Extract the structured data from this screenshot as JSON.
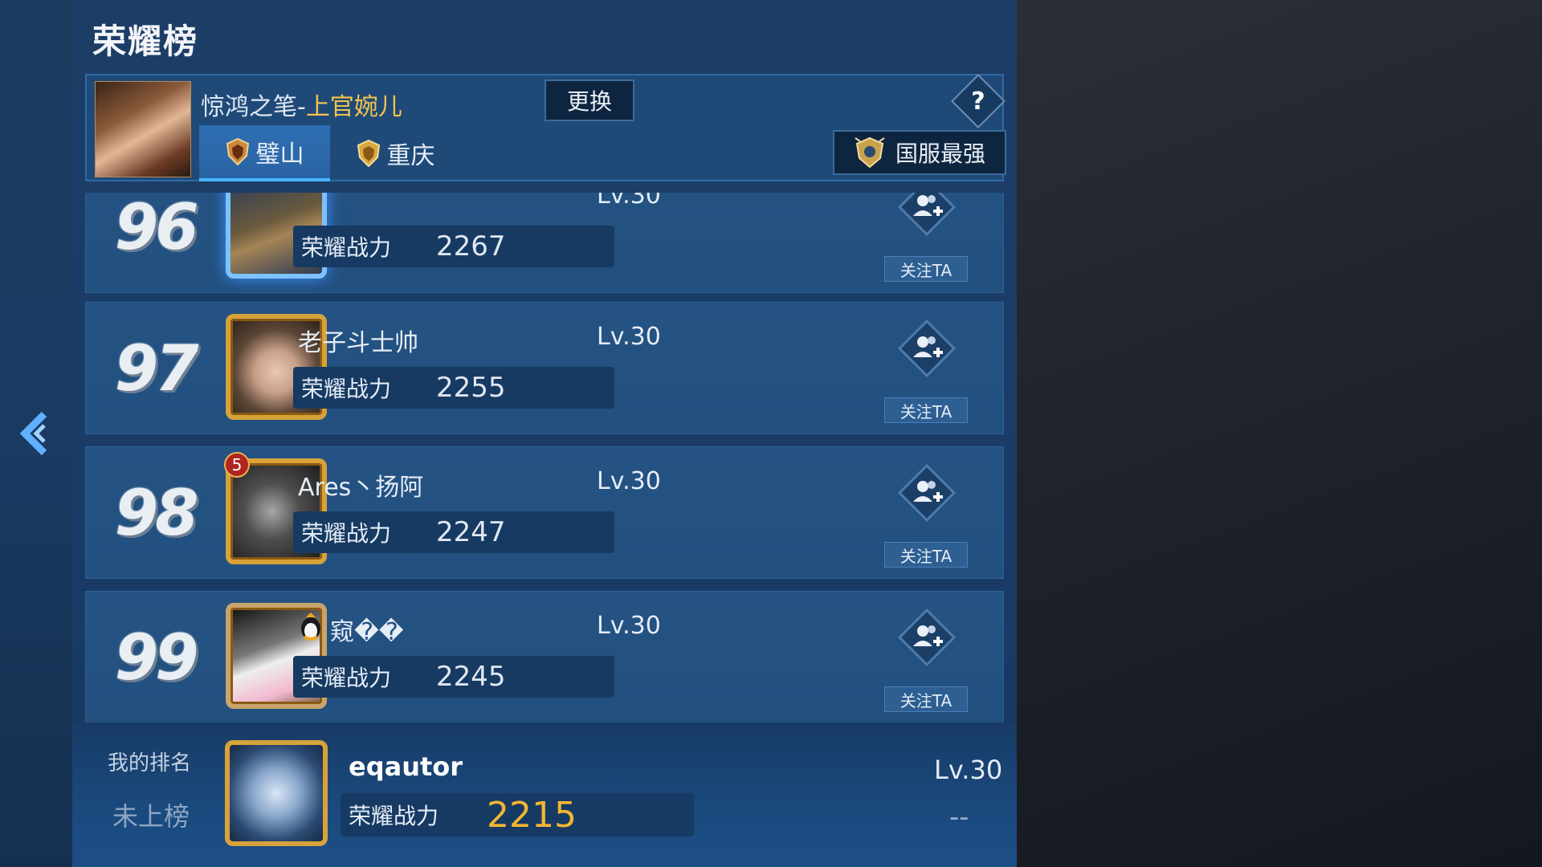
{
  "screen": {
    "title": "荣耀榜",
    "hero": {
      "name_prefix": "惊鸿之笔-",
      "name_highlight": "上官婉儿",
      "change_label": "更换",
      "help_label": "?"
    },
    "tabs": [
      {
        "label": "璧山",
        "active": true
      },
      {
        "label": "重庆",
        "active": false
      }
    ],
    "national_label": "国服最强"
  },
  "power_label": "荣耀战力",
  "follow_label": "关注TA",
  "rows": [
    {
      "rank": "96",
      "name": "",
      "level": "Lv.30",
      "power": "2267"
    },
    {
      "rank": "97",
      "name": "老子斗士帅",
      "level": "Lv.30",
      "power": "2255"
    },
    {
      "rank": "98",
      "name": "Ares丶扬阿",
      "level": "Lv.30",
      "power": "2247",
      "badge": "5"
    },
    {
      "rank": "99",
      "name": "窥��",
      "level": "Lv.30",
      "power": "2245"
    }
  ],
  "me": {
    "label": "我的排名",
    "status": "未上榜",
    "name": "eqautor",
    "level": "Lv.30",
    "power": "2215",
    "extra": "--"
  },
  "colors": {
    "accent_gold": "#f1c34c",
    "my_power": "#f3b632",
    "active_tab_underline": "#49b6ff"
  }
}
